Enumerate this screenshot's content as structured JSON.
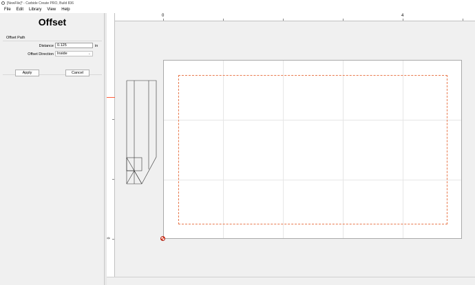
{
  "window": {
    "title": "[NewFile]* - Carbide Create PRO, Build 836"
  },
  "menu": {
    "items": [
      "File",
      "Edit",
      "Library",
      "View",
      "Help"
    ]
  },
  "panel": {
    "title": "Offset",
    "section": "Offset Path",
    "distance_label": "Distance",
    "distance_value": "0.125",
    "unit": "in",
    "direction_label": "Offset Direction",
    "direction_value": "Inside",
    "apply_label": "Apply",
    "cancel_label": "Cancel"
  },
  "rulers": {
    "h_label_0": "0",
    "h_label_4": "4",
    "v_label_0": "0"
  },
  "colors": {
    "offset_path": "#e8774a",
    "ruler_marker": "#ff5a36",
    "origin": "#e03a1e"
  }
}
